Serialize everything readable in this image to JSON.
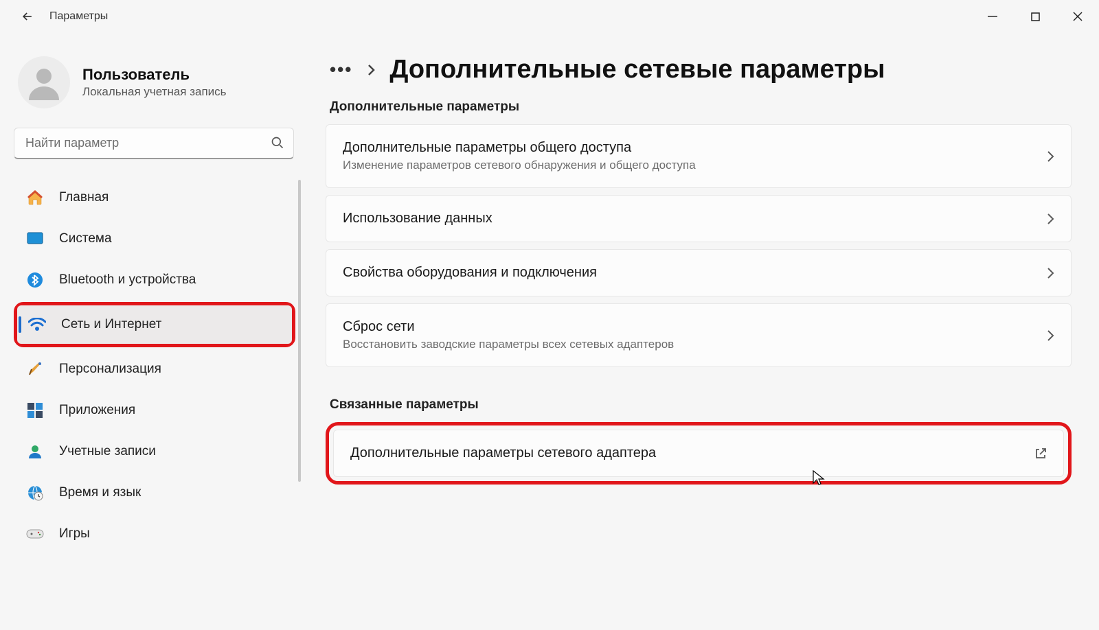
{
  "app": {
    "title": "Параметры"
  },
  "user": {
    "name": "Пользователь",
    "subtitle": "Локальная учетная запись"
  },
  "search": {
    "placeholder": "Найти параметр"
  },
  "sidebar": {
    "items": [
      {
        "label": "Главная"
      },
      {
        "label": "Система"
      },
      {
        "label": "Bluetooth и устройства"
      },
      {
        "label": "Сеть и Интернет"
      },
      {
        "label": "Персонализация"
      },
      {
        "label": "Приложения"
      },
      {
        "label": "Учетные записи"
      },
      {
        "label": "Время и язык"
      },
      {
        "label": "Игры"
      }
    ]
  },
  "breadcrumb": {
    "current": "Дополнительные сетевые параметры"
  },
  "sections": {
    "advanced": {
      "heading": "Дополнительные параметры",
      "items": [
        {
          "title": "Дополнительные параметры общего доступа",
          "sub": "Изменение параметров сетевого обнаружения и общего доступа"
        },
        {
          "title": "Использование данных",
          "sub": ""
        },
        {
          "title": "Свойства оборудования и подключения",
          "sub": ""
        },
        {
          "title": "Сброс сети",
          "sub": "Восстановить заводские параметры всех сетевых адаптеров"
        }
      ]
    },
    "related": {
      "heading": "Связанные параметры",
      "items": [
        {
          "title": "Дополнительные параметры сетевого адаптера"
        }
      ]
    }
  }
}
